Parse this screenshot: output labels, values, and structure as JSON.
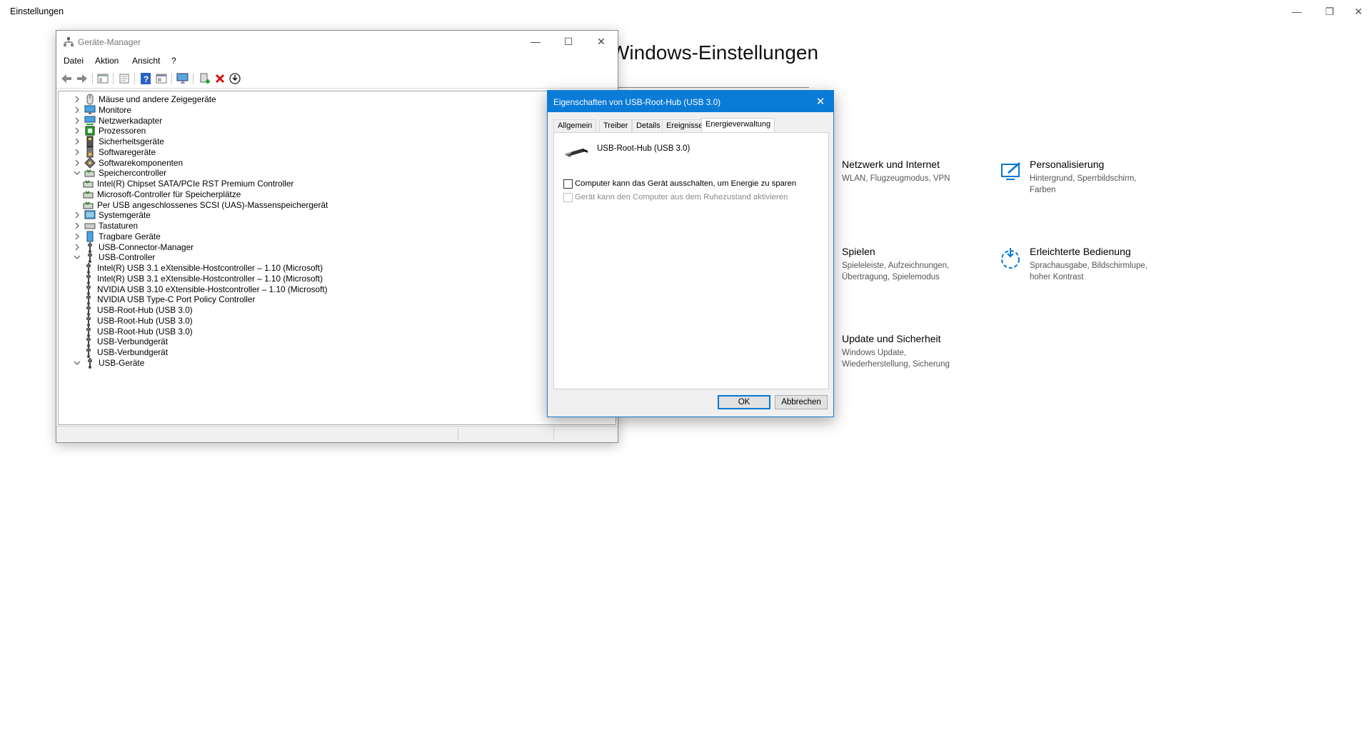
{
  "settings": {
    "window_title": "Einstellungen",
    "heading": "Windows-Einstellungen",
    "tiles": [
      {
        "title": "Netzwerk und Internet",
        "desc": "WLAN, Flugzeugmodus, VPN",
        "icon": "network-icon"
      },
      {
        "title": "Personalisierung",
        "desc": "Hintergrund, Sperrbildschirm, Farben",
        "icon": "personalization-icon"
      },
      {
        "title": "Spielen",
        "desc": "Spieleleiste, Aufzeichnungen, Übertragung, Spielemodus",
        "icon": "gaming-icon"
      },
      {
        "title": "Erleichterte Bedienung",
        "desc": "Sprachausgabe, Bildschirmlupe, hoher Kontrast",
        "icon": "ease-of-access-icon"
      },
      {
        "title": "Update und Sicherheit",
        "desc": "Windows Update, Wiederherstellung, Sicherung",
        "icon": "update-icon"
      }
    ]
  },
  "device_manager": {
    "title": "Geräte-Manager",
    "menu": [
      "Datei",
      "Aktion",
      "Ansicht",
      "?"
    ],
    "tree": [
      {
        "label": "Mäuse und andere Zeigegeräte",
        "state": "collapsed",
        "level": 0,
        "icon": "mouse-icon"
      },
      {
        "label": "Monitore",
        "state": "collapsed",
        "level": 0,
        "icon": "monitor-icon"
      },
      {
        "label": "Netzwerkadapter",
        "state": "collapsed",
        "level": 0,
        "icon": "network-adapter-icon"
      },
      {
        "label": "Prozessoren",
        "state": "collapsed",
        "level": 0,
        "icon": "processor-icon"
      },
      {
        "label": "Sicherheitsgeräte",
        "state": "collapsed",
        "level": 0,
        "icon": "security-device-icon"
      },
      {
        "label": "Softwaregeräte",
        "state": "collapsed",
        "level": 0,
        "icon": "software-device-icon"
      },
      {
        "label": "Softwarekomponenten",
        "state": "collapsed",
        "level": 0,
        "icon": "software-component-icon"
      },
      {
        "label": "Speichercontroller",
        "state": "expanded",
        "level": 0,
        "icon": "storage-controller-icon"
      },
      {
        "label": "Intel(R) Chipset SATA/PCIe RST Premium Controller",
        "state": "leaf",
        "level": 1,
        "icon": "storage-controller-icon"
      },
      {
        "label": "Microsoft-Controller für Speicherplätze",
        "state": "leaf",
        "level": 1,
        "icon": "storage-controller-icon"
      },
      {
        "label": "Per USB angeschlossenes SCSI (UAS)-Massenspeichergerät",
        "state": "leaf",
        "level": 1,
        "icon": "storage-controller-icon"
      },
      {
        "label": "Systemgeräte",
        "state": "collapsed",
        "level": 0,
        "icon": "system-device-icon"
      },
      {
        "label": "Tastaturen",
        "state": "collapsed",
        "level": 0,
        "icon": "keyboard-icon"
      },
      {
        "label": "Tragbare Geräte",
        "state": "collapsed",
        "level": 0,
        "icon": "portable-device-icon"
      },
      {
        "label": "USB-Connector-Manager",
        "state": "collapsed",
        "level": 0,
        "icon": "usb-icon"
      },
      {
        "label": "USB-Controller",
        "state": "expanded",
        "level": 0,
        "icon": "usb-icon"
      },
      {
        "label": "Intel(R) USB 3.1 eXtensible-Hostcontroller – 1.10 (Microsoft)",
        "state": "leaf",
        "level": 1,
        "icon": "usb-icon"
      },
      {
        "label": "Intel(R) USB 3.1 eXtensible-Hostcontroller – 1.10 (Microsoft)",
        "state": "leaf",
        "level": 1,
        "icon": "usb-icon"
      },
      {
        "label": "NVIDIA USB 3.10 eXtensible-Hostcontroller – 1.10 (Microsoft)",
        "state": "leaf",
        "level": 1,
        "icon": "usb-icon"
      },
      {
        "label": "NVIDIA USB Type-C Port Policy Controller",
        "state": "leaf",
        "level": 1,
        "icon": "usb-icon"
      },
      {
        "label": "USB-Root-Hub (USB 3.0)",
        "state": "leaf",
        "level": 1,
        "icon": "usb-icon"
      },
      {
        "label": "USB-Root-Hub (USB 3.0)",
        "state": "leaf",
        "level": 1,
        "icon": "usb-icon"
      },
      {
        "label": "USB-Root-Hub (USB 3.0)",
        "state": "leaf",
        "level": 1,
        "icon": "usb-icon"
      },
      {
        "label": "USB-Verbundgerät",
        "state": "leaf",
        "level": 1,
        "icon": "usb-icon"
      },
      {
        "label": "USB-Verbundgerät",
        "state": "leaf",
        "level": 1,
        "icon": "usb-icon"
      },
      {
        "label": "USB-Geräte",
        "state": "expanded",
        "level": 0,
        "icon": "usb-icon"
      }
    ]
  },
  "dialog": {
    "title": "Eigenschaften von USB-Root-Hub (USB 3.0)",
    "tabs": [
      "Allgemein",
      "Treiber",
      "Details",
      "Ereignisse",
      "Energieverwaltung"
    ],
    "active_tab": "Energieverwaltung",
    "device_name": "USB-Root-Hub (USB 3.0)",
    "options": [
      {
        "label": "Computer kann das Gerät ausschalten, um Energie zu sparen",
        "checked": false,
        "enabled": true
      },
      {
        "label": "Gerät kann den Computer aus dem Ruhezustand aktivieren",
        "checked": false,
        "enabled": false
      }
    ],
    "ok_label": "OK",
    "cancel_label": "Abbrechen"
  },
  "colors": {
    "accent": "#0078d7",
    "dialog_titlebar": "#0a7bd7"
  }
}
